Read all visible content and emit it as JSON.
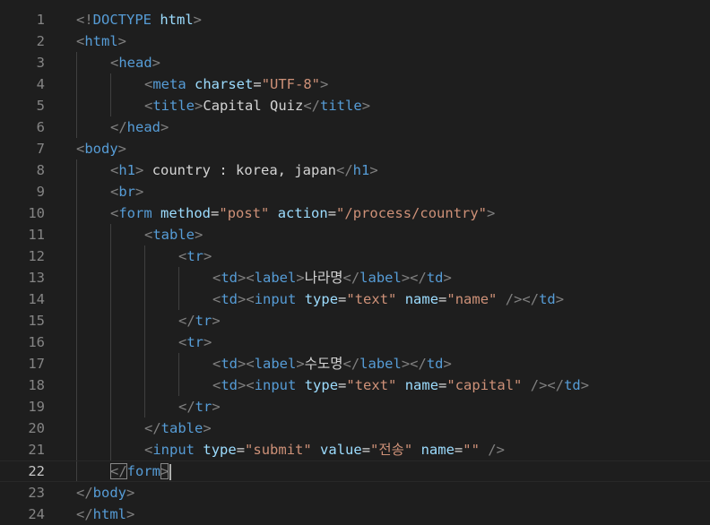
{
  "editor": {
    "current_line": 22,
    "colors": {
      "background": "#1e1e1e",
      "tag": "#569cd6",
      "attribute": "#9cdcfe",
      "string": "#ce9178",
      "text": "#d4d4d4",
      "punct": "#808080",
      "line_number": "#858585",
      "line_number_active": "#c6c6c6"
    },
    "lines": [
      {
        "n": "1",
        "indent": 0,
        "tokens": [
          [
            "p",
            "<!"
          ],
          [
            "k",
            "DOCTYPE"
          ],
          [
            "t",
            " "
          ],
          [
            "a",
            "html"
          ],
          [
            "p",
            ">"
          ]
        ]
      },
      {
        "n": "2",
        "indent": 0,
        "tokens": [
          [
            "p",
            "<"
          ],
          [
            "k",
            "html"
          ],
          [
            "p",
            ">"
          ]
        ]
      },
      {
        "n": "3",
        "indent": 1,
        "tokens": [
          [
            "p",
            "<"
          ],
          [
            "k",
            "head"
          ],
          [
            "p",
            ">"
          ]
        ]
      },
      {
        "n": "4",
        "indent": 2,
        "tokens": [
          [
            "p",
            "<"
          ],
          [
            "k",
            "meta"
          ],
          [
            "t",
            " "
          ],
          [
            "a",
            "charset"
          ],
          [
            "t",
            "="
          ],
          [
            "s",
            "\"UTF-8\""
          ],
          [
            "p",
            ">"
          ]
        ]
      },
      {
        "n": "5",
        "indent": 2,
        "tokens": [
          [
            "p",
            "<"
          ],
          [
            "k",
            "title"
          ],
          [
            "p",
            ">"
          ],
          [
            "t",
            "Capital Quiz"
          ],
          [
            "p",
            "</"
          ],
          [
            "k",
            "title"
          ],
          [
            "p",
            ">"
          ]
        ]
      },
      {
        "n": "6",
        "indent": 1,
        "tokens": [
          [
            "p",
            "</"
          ],
          [
            "k",
            "head"
          ],
          [
            "p",
            ">"
          ]
        ]
      },
      {
        "n": "7",
        "indent": 0,
        "tokens": [
          [
            "p",
            "<"
          ],
          [
            "k",
            "body"
          ],
          [
            "p",
            ">"
          ]
        ]
      },
      {
        "n": "8",
        "indent": 1,
        "tokens": [
          [
            "p",
            "<"
          ],
          [
            "k",
            "h1"
          ],
          [
            "p",
            ">"
          ],
          [
            "t",
            " country : korea, japan"
          ],
          [
            "p",
            "</"
          ],
          [
            "k",
            "h1"
          ],
          [
            "p",
            ">"
          ]
        ]
      },
      {
        "n": "9",
        "indent": 1,
        "tokens": [
          [
            "p",
            "<"
          ],
          [
            "k",
            "br"
          ],
          [
            "p",
            ">"
          ]
        ]
      },
      {
        "n": "10",
        "indent": 1,
        "tokens": [
          [
            "p",
            "<"
          ],
          [
            "k",
            "form"
          ],
          [
            "t",
            " "
          ],
          [
            "a",
            "method"
          ],
          [
            "t",
            "="
          ],
          [
            "s",
            "\"post\""
          ],
          [
            "t",
            " "
          ],
          [
            "a",
            "action"
          ],
          [
            "t",
            "="
          ],
          [
            "s",
            "\"/process/country\""
          ],
          [
            "p",
            ">"
          ]
        ]
      },
      {
        "n": "11",
        "indent": 2,
        "tokens": [
          [
            "p",
            "<"
          ],
          [
            "k",
            "table"
          ],
          [
            "p",
            ">"
          ]
        ]
      },
      {
        "n": "12",
        "indent": 3,
        "tokens": [
          [
            "p",
            "<"
          ],
          [
            "k",
            "tr"
          ],
          [
            "p",
            ">"
          ]
        ]
      },
      {
        "n": "13",
        "indent": 4,
        "tokens": [
          [
            "p",
            "<"
          ],
          [
            "k",
            "td"
          ],
          [
            "p",
            "><"
          ],
          [
            "k",
            "label"
          ],
          [
            "p",
            ">"
          ],
          [
            "t",
            "나라명"
          ],
          [
            "p",
            "</"
          ],
          [
            "k",
            "label"
          ],
          [
            "p",
            "></"
          ],
          [
            "k",
            "td"
          ],
          [
            "p",
            ">"
          ]
        ]
      },
      {
        "n": "14",
        "indent": 4,
        "tokens": [
          [
            "p",
            "<"
          ],
          [
            "k",
            "td"
          ],
          [
            "p",
            "><"
          ],
          [
            "k",
            "input"
          ],
          [
            "t",
            " "
          ],
          [
            "a",
            "type"
          ],
          [
            "t",
            "="
          ],
          [
            "s",
            "\"text\""
          ],
          [
            "t",
            " "
          ],
          [
            "a",
            "name"
          ],
          [
            "t",
            "="
          ],
          [
            "s",
            "\"name\""
          ],
          [
            "t",
            " "
          ],
          [
            "p",
            "/></"
          ],
          [
            "k",
            "td"
          ],
          [
            "p",
            ">"
          ]
        ]
      },
      {
        "n": "15",
        "indent": 3,
        "tokens": [
          [
            "p",
            "</"
          ],
          [
            "k",
            "tr"
          ],
          [
            "p",
            ">"
          ]
        ]
      },
      {
        "n": "16",
        "indent": 3,
        "tokens": [
          [
            "p",
            "<"
          ],
          [
            "k",
            "tr"
          ],
          [
            "p",
            ">"
          ]
        ]
      },
      {
        "n": "17",
        "indent": 4,
        "tokens": [
          [
            "p",
            "<"
          ],
          [
            "k",
            "td"
          ],
          [
            "p",
            "><"
          ],
          [
            "k",
            "label"
          ],
          [
            "p",
            ">"
          ],
          [
            "t",
            "수도명"
          ],
          [
            "p",
            "</"
          ],
          [
            "k",
            "label"
          ],
          [
            "p",
            "></"
          ],
          [
            "k",
            "td"
          ],
          [
            "p",
            ">"
          ]
        ]
      },
      {
        "n": "18",
        "indent": 4,
        "tokens": [
          [
            "p",
            "<"
          ],
          [
            "k",
            "td"
          ],
          [
            "p",
            "><"
          ],
          [
            "k",
            "input"
          ],
          [
            "t",
            " "
          ],
          [
            "a",
            "type"
          ],
          [
            "t",
            "="
          ],
          [
            "s",
            "\"text\""
          ],
          [
            "t",
            " "
          ],
          [
            "a",
            "name"
          ],
          [
            "t",
            "="
          ],
          [
            "s",
            "\"capital\""
          ],
          [
            "t",
            " "
          ],
          [
            "p",
            "/></"
          ],
          [
            "k",
            "td"
          ],
          [
            "p",
            ">"
          ]
        ]
      },
      {
        "n": "19",
        "indent": 3,
        "tokens": [
          [
            "p",
            "</"
          ],
          [
            "k",
            "tr"
          ],
          [
            "p",
            ">"
          ]
        ]
      },
      {
        "n": "20",
        "indent": 2,
        "tokens": [
          [
            "p",
            "</"
          ],
          [
            "k",
            "table"
          ],
          [
            "p",
            ">"
          ]
        ]
      },
      {
        "n": "21",
        "indent": 2,
        "tokens": [
          [
            "p",
            "<"
          ],
          [
            "k",
            "input"
          ],
          [
            "t",
            " "
          ],
          [
            "a",
            "type"
          ],
          [
            "t",
            "="
          ],
          [
            "s",
            "\"submit\""
          ],
          [
            "t",
            " "
          ],
          [
            "a",
            "value"
          ],
          [
            "t",
            "="
          ],
          [
            "s",
            "\"전송\""
          ],
          [
            "t",
            " "
          ],
          [
            "a",
            "name"
          ],
          [
            "t",
            "="
          ],
          [
            "s",
            "\"\""
          ],
          [
            "t",
            " "
          ],
          [
            "p",
            "/>"
          ]
        ]
      },
      {
        "n": "22",
        "indent": 1,
        "tokens": [
          [
            "p",
            "</"
          ],
          [
            "k",
            "form"
          ],
          [
            "p",
            ">"
          ]
        ]
      },
      {
        "n": "23",
        "indent": 0,
        "tokens": [
          [
            "p",
            "</"
          ],
          [
            "k",
            "body"
          ],
          [
            "p",
            ">"
          ]
        ]
      },
      {
        "n": "24",
        "indent": 0,
        "tokens": [
          [
            "p",
            "</"
          ],
          [
            "k",
            "html"
          ],
          [
            "p",
            ">"
          ]
        ]
      }
    ]
  }
}
